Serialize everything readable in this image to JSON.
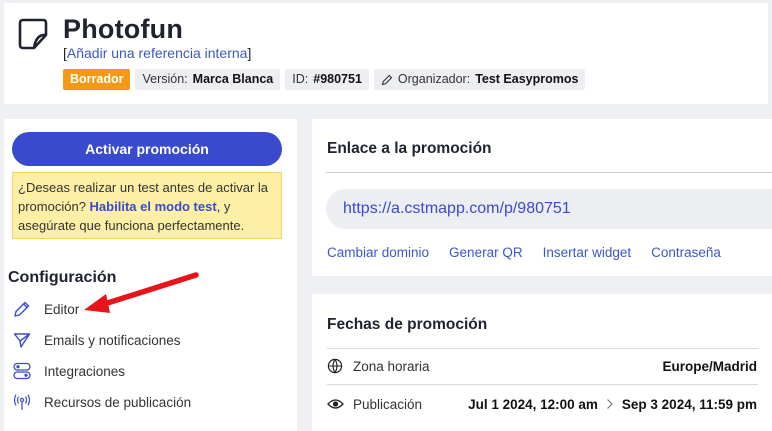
{
  "header": {
    "app_title": "Photofun",
    "ref_open": "[",
    "ref_link": "Añadir una referencia interna",
    "ref_close": "]",
    "badges": {
      "status": "Borrador",
      "version_label": "Versión:",
      "version_value": "Marca Blanca",
      "id_label": "ID:",
      "id_value": "#980751",
      "organizer_label": "Organizador:",
      "organizer_value": "Test Easypromos"
    }
  },
  "left": {
    "activate_label": "Activar promoción",
    "notice": {
      "text_before": "¿Deseas realizar un test antes de activar la promoción? ",
      "link": "Habilita el modo test",
      "text_after": ", y asegúrate que funciona perfectamente."
    },
    "config_title": "Configuración",
    "menu": [
      {
        "label": "Editor",
        "icon": "pencil-icon"
      },
      {
        "label": "Emails y notificaciones",
        "icon": "send-icon"
      },
      {
        "label": "Integraciones",
        "icon": "toggles-icon"
      },
      {
        "label": "Recursos de publicación",
        "icon": "broadcast-icon"
      }
    ],
    "annotation_color": "#e8141b"
  },
  "link_card": {
    "title": "Enlace a la promoción",
    "url": "https://a.cstmapp.com/p/980751",
    "actions": [
      "Cambiar dominio",
      "Generar QR",
      "Insertar widget",
      "Contraseña"
    ]
  },
  "dates_card": {
    "title": "Fechas de promoción",
    "timezone_label": "Zona horaria",
    "timezone_value": "Europe/Madrid",
    "publication_label": "Publicación",
    "publication_start": "Jul 1 2024, 12:00 am",
    "publication_end": "Sep 3 2024, 11:59 pm"
  },
  "colors": {
    "accent": "#3a4acd",
    "status_badge": "#f29a15",
    "notice_bg": "#fdf0a6"
  }
}
